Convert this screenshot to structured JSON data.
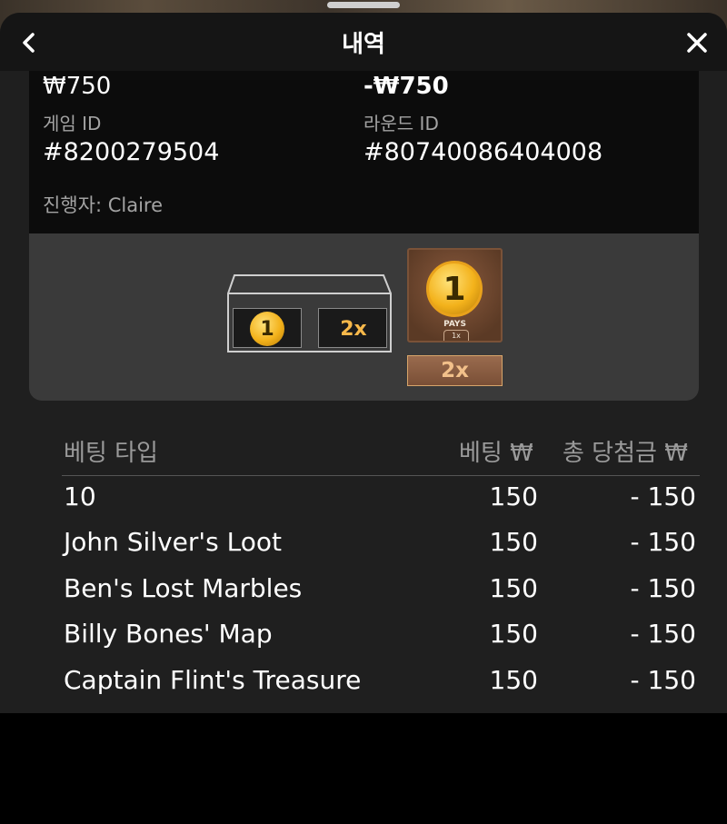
{
  "header": {
    "title": "내역"
  },
  "summary": {
    "bet_amount": "₩750",
    "result_amount": "-₩750",
    "game_id_label": "게임 ID",
    "game_id": "#8200279504",
    "round_id_label": "라운드 ID",
    "round_id": "#80740086404008",
    "host": "진행자: Claire"
  },
  "game_result": {
    "slot_coin_value": "1",
    "slot_multiplier": "2x",
    "card_coin_value": "1",
    "card_pays_label": "PAYS",
    "card_pays_multiplier": "1x",
    "multiplier_chip": "2x"
  },
  "table": {
    "columns": [
      "베팅 타입",
      "베팅 ₩",
      "총 당첨금 ₩"
    ],
    "rows": [
      {
        "type": "10",
        "bet": "150",
        "win": "- 150"
      },
      {
        "type": "John Silver's Loot",
        "bet": "150",
        "win": "- 150"
      },
      {
        "type": "Ben's Lost Marbles",
        "bet": "150",
        "win": "- 150"
      },
      {
        "type": "Billy Bones' Map",
        "bet": "150",
        "win": "- 150"
      },
      {
        "type": "Captain Flint's Treasure",
        "bet": "150",
        "win": "- 150"
      }
    ]
  },
  "colors": {
    "background": "#1f1f1f",
    "header": "#151515",
    "panel": "#3a3a3a",
    "accent_gold": "#f3b21b"
  }
}
